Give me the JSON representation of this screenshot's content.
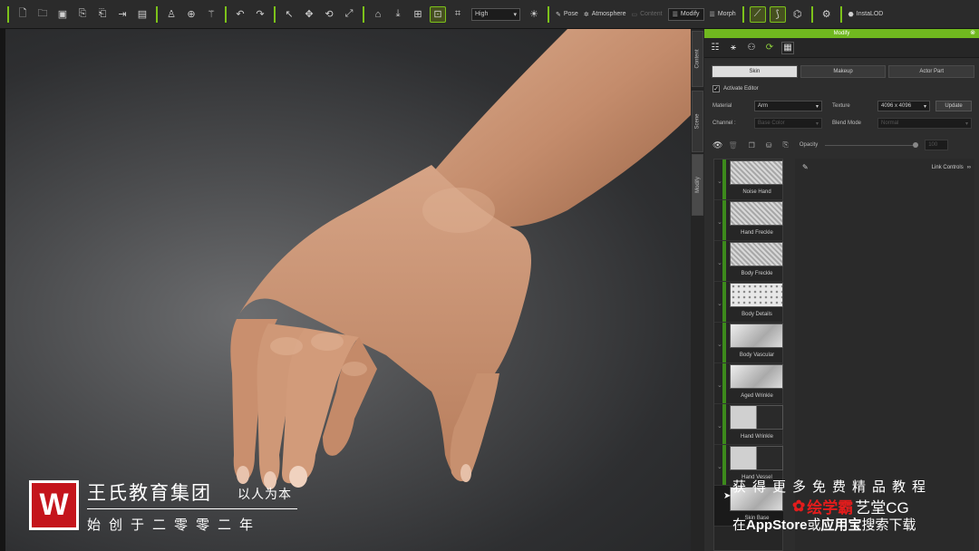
{
  "toolbar": {
    "quality_select": "High",
    "pose": "Pose",
    "atmosphere": "Atmosphere",
    "content": "Content",
    "modify": "Modify",
    "morph": "Morph",
    "installod": "InstaLOD"
  },
  "side_tabs": {
    "content": "Content",
    "scene": "Scene",
    "modify": "Modify"
  },
  "panel": {
    "title": "Modify",
    "close": "⊗",
    "tabs": [
      "Skin",
      "Makeup",
      "Actor Part"
    ],
    "activate_editor": "Activate Editor",
    "material_label": "Material",
    "material_value": "Arm",
    "texture_label": "Texture",
    "texture_value": "4096 x 4096",
    "update_button": "Update",
    "channel_label": "Channel :",
    "channel_value": "Base Color",
    "blend_label": "Blend Mode",
    "blend_value": "Normal",
    "opacity_label": "Opacity",
    "opacity_value": "100",
    "link_controls": "Link Controls",
    "layers": [
      "Noise Hand",
      "Hand Freckle",
      "Body Freckle",
      "Body Details",
      "Body Vascular",
      "Aged Wrinkle",
      "Hand Wrinkle",
      "Hand Vessel",
      "Skin Base"
    ]
  },
  "watermark": {
    "logo_letter": "W",
    "title": "王氏教育集团",
    "slogan": "以人为本",
    "sub": "始创于二零零二年",
    "right_line1": "获得更多免费精品教程",
    "brand_red": "绘学霸",
    "brand_white": "艺堂CG",
    "right_line2_a": "在",
    "right_line2_b": "AppStore",
    "right_line2_c": "或",
    "right_line2_d": "应用宝",
    "right_line2_e": "搜索下载"
  }
}
